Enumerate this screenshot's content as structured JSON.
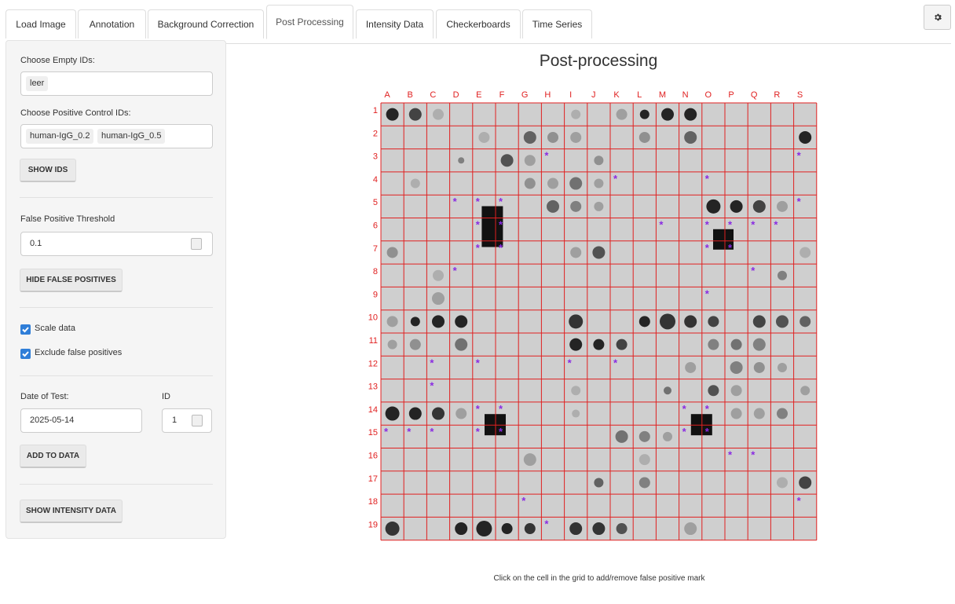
{
  "tabs": [
    "Load Image",
    "Annotation",
    "Background Correction",
    "Post Processing",
    "Intensity Data",
    "Checkerboards",
    "Time Series"
  ],
  "active_tab": "Post Processing",
  "sidebar": {
    "empty_ids_label": "Choose Empty IDs:",
    "empty_ids": [
      "leer"
    ],
    "positive_ids_label": "Choose Positive Control IDs:",
    "positive_ids": [
      "human-IgG_0.2",
      "human-IgG_0.5"
    ],
    "show_ids_button": "SHOW IDS",
    "fp_threshold_label": "False Positive Threshold",
    "fp_threshold_value": "0.1",
    "hide_fp_button": "HIDE FALSE POSITIVES",
    "scale_data_label": "Scale data",
    "scale_data_checked": true,
    "exclude_fp_label": "Exclude false positives",
    "exclude_fp_checked": true,
    "date_label": "Date of Test:",
    "date_value": "2025-05-14",
    "id_label": "ID",
    "id_value": "1",
    "add_data_button": "ADD TO DATA",
    "show_intensity_button": "SHOW INTENSITY DATA"
  },
  "plot": {
    "title": "Post-processing",
    "columns": [
      "A",
      "B",
      "C",
      "D",
      "E",
      "F",
      "G",
      "H",
      "I",
      "J",
      "K",
      "L",
      "M",
      "N",
      "O",
      "P",
      "Q",
      "R",
      "S"
    ],
    "rows": [
      "1",
      "2",
      "3",
      "4",
      "5",
      "6",
      "7",
      "8",
      "9",
      "10",
      "11",
      "12",
      "13",
      "14",
      "15",
      "16",
      "17",
      "18",
      "19"
    ],
    "grid_color": "#e02020",
    "mark_color": "#8a2be2",
    "false_positive_marks": [
      "S3",
      "H3",
      "K4",
      "O4",
      "D5",
      "E5",
      "F5",
      "S5",
      "E6",
      "F6",
      "M6",
      "O6",
      "P6",
      "Q6",
      "R6",
      "E7",
      "F7",
      "O7",
      "P7",
      "D8",
      "Q8",
      "O9",
      "C12",
      "E12",
      "I12",
      "K12",
      "C13",
      "E14",
      "F14",
      "N14",
      "O14",
      "A15",
      "B15",
      "C15",
      "E15",
      "F15",
      "N15",
      "O15",
      "P16",
      "Q16",
      "G18",
      "S18",
      "H19"
    ],
    "hint": "Click on the cell in the grid to add/remove false positive mark"
  }
}
